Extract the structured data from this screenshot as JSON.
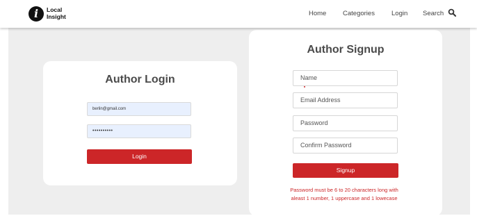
{
  "brand": {
    "line1": "Local",
    "line2": "Insight",
    "logo_glyph": "i"
  },
  "nav": {
    "home": "Home",
    "categories": "Categories",
    "login": "Login",
    "search": "Search"
  },
  "login_card": {
    "title": "Author Login",
    "email_value": "berlin@gmail.com",
    "password_value": "••••••••••",
    "button_label": "Login"
  },
  "signup_card": {
    "title": "Author Signup",
    "name_placeholder": "Name",
    "email_placeholder": "Email Address",
    "password_placeholder": "Password",
    "confirm_placeholder": "Confirm Password",
    "button_label": "Signup",
    "hint_line1": "Password must be 6 to 20 characters long with",
    "hint_line2": "aleast 1 number, 1 uppercase and 1 lowecase"
  },
  "colors": {
    "accent_red": "#cc2628",
    "autofill_blue": "#e8f0fe",
    "page_grey": "#eeeeee"
  },
  "icons": {
    "search": "magnifier-icon",
    "logo": "info-logo-icon"
  }
}
